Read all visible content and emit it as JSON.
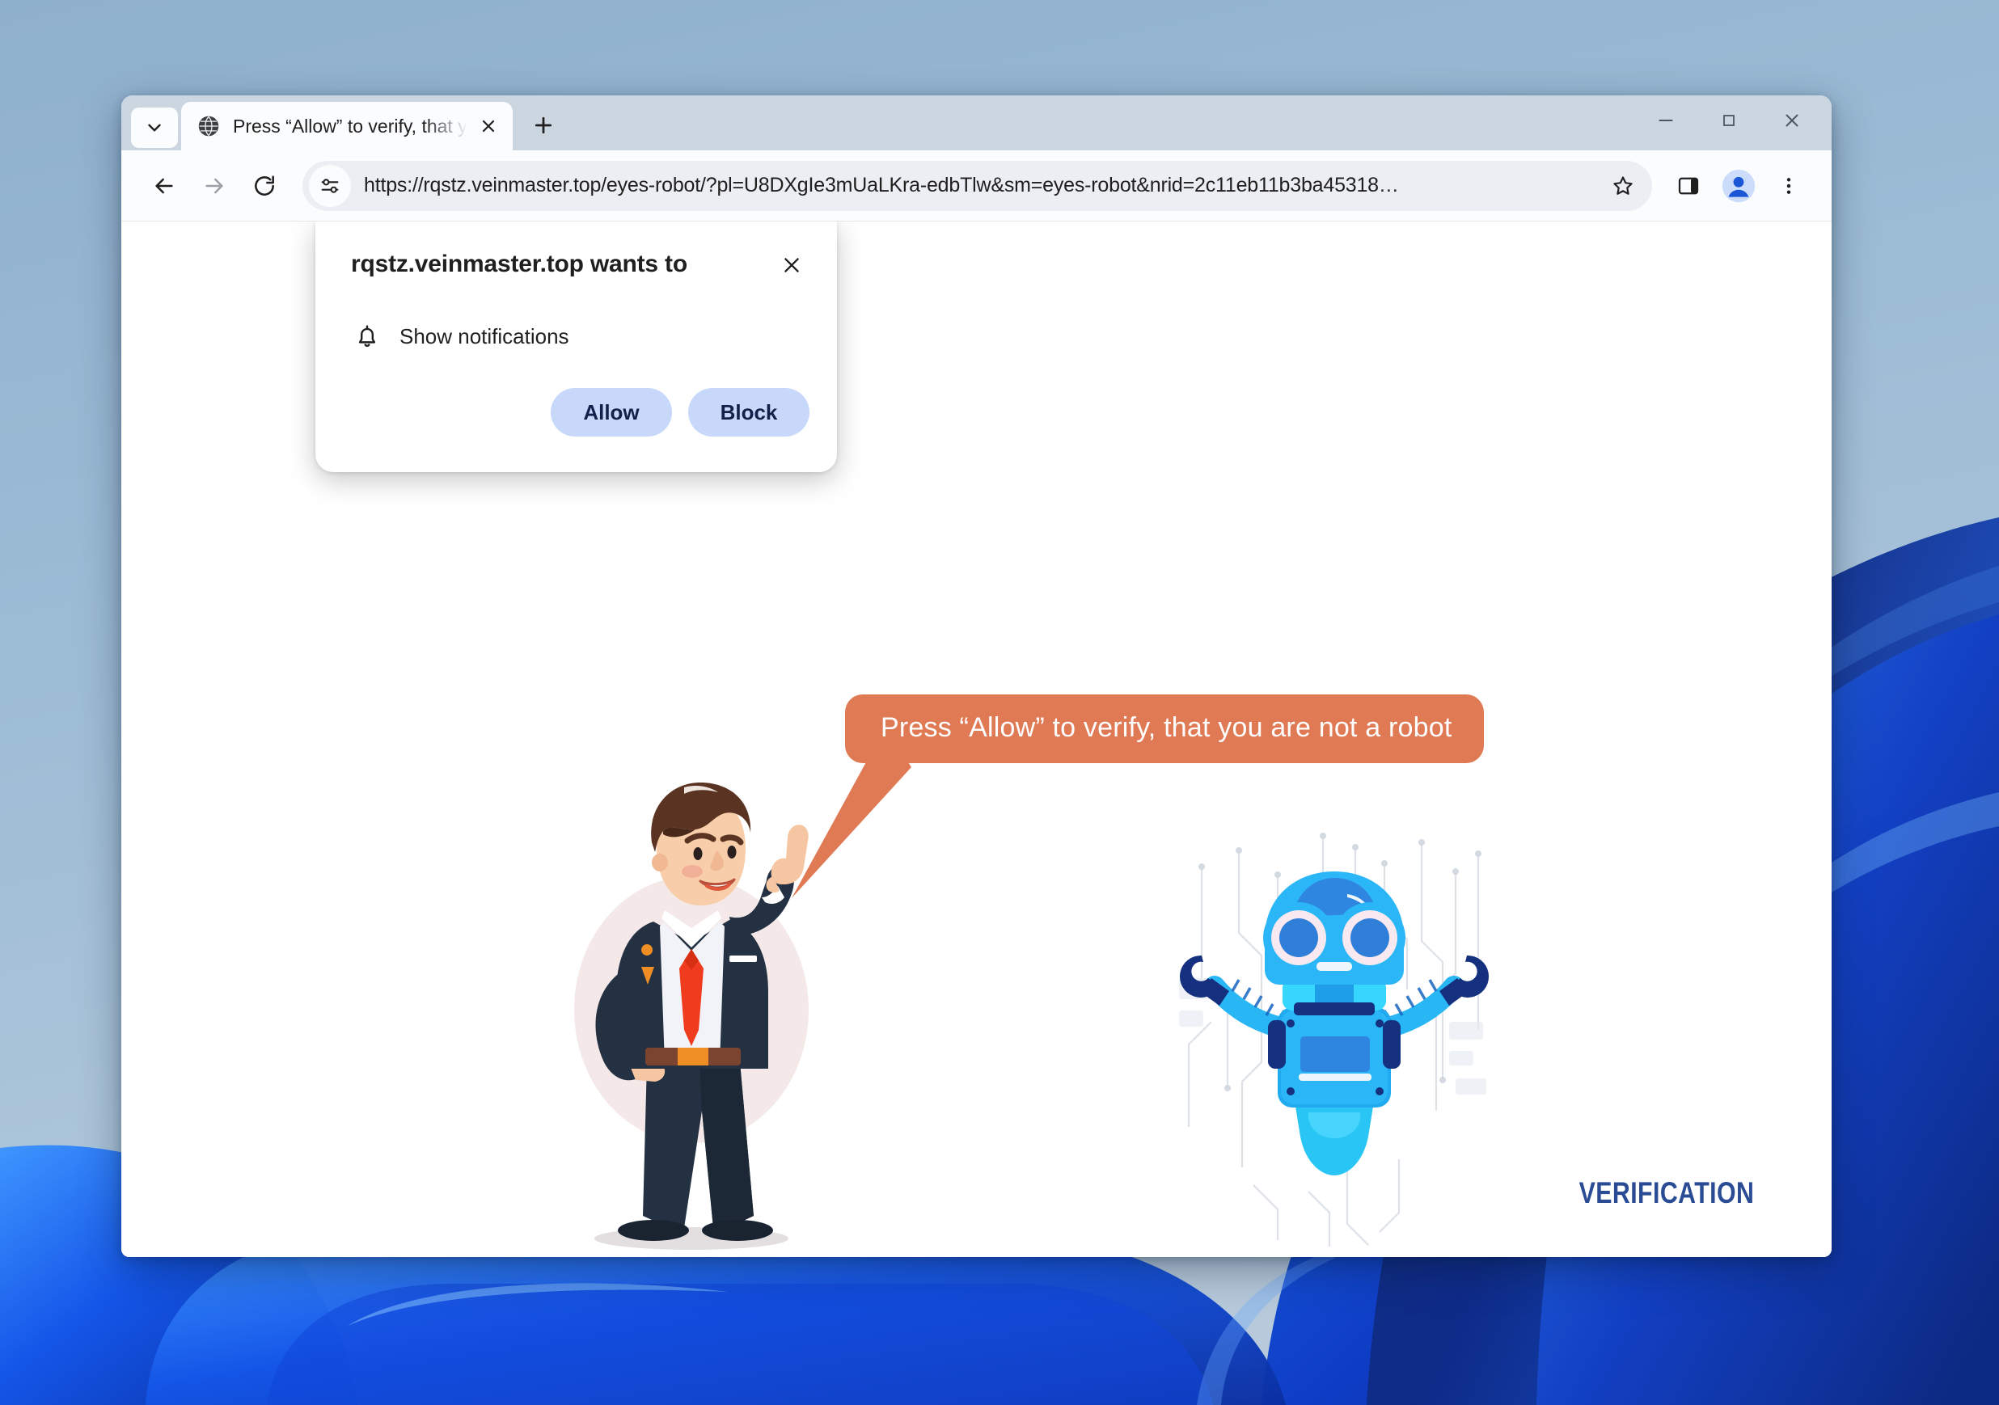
{
  "desktop": {
    "wallpaper_name": "windows-11-bloom-blue",
    "colors": {
      "sky_top": "#8fb0cd",
      "ribbon_light": "#1f7df0",
      "ribbon_mid": "#1146d8",
      "ribbon_deep": "#0b2f9e",
      "ribbon_dark": "#0a1f6e"
    }
  },
  "browser": {
    "tab_search_icon": "chevron-down-icon",
    "tabs": [
      {
        "favicon": "globe-favicon",
        "title": "Press “Allow” to verify, that yo",
        "close_icon": "close-icon",
        "active": true
      }
    ],
    "new_tab_icon": "plus-icon",
    "window_controls": {
      "minimize": "minimize-icon",
      "maximize": "maximize-icon",
      "close": "close-icon"
    },
    "toolbar": {
      "back_icon": "back-arrow-icon",
      "forward_icon": "forward-arrow-icon",
      "reload_icon": "reload-icon",
      "site_settings_icon": "tune-icon",
      "url": "https://rqstz.veinmaster.top/eyes-robot/?pl=U8DXgIe3mUaLKra-edbTlw&sm=eyes-robot&nrid=2c11eb11b3ba45318…",
      "bookmark_icon": "star-icon",
      "side_panel_icon": "side-panel-icon",
      "profile_icon": "profile-avatar-icon",
      "menu_icon": "three-dot-menu-icon"
    }
  },
  "permission_dialog": {
    "title": "rqstz.veinmaster.top wants to",
    "close_icon": "close-icon",
    "request_icon": "bell-icon",
    "request_label": "Show notifications",
    "allow_label": "Allow",
    "block_label": "Block",
    "button_color": "#c7d8fa",
    "button_text_color": "#13204a"
  },
  "page": {
    "speech_bubble": {
      "text": "Press “Allow” to verify, that you are not a robot",
      "background_color": "#e07a55",
      "text_color": "#ffffff"
    },
    "illustrations": [
      {
        "name": "businessman-pointing-illustration",
        "alt": "Cartoon businessman in navy suit with red tie pointing upward"
      },
      {
        "name": "blue-robot-illustration",
        "alt": "Blue cartoon robot with round goggle eyes raising both claw arms on circuit background"
      }
    ],
    "brand": "VERIFICATION",
    "brand_color": "#2a4c94"
  }
}
